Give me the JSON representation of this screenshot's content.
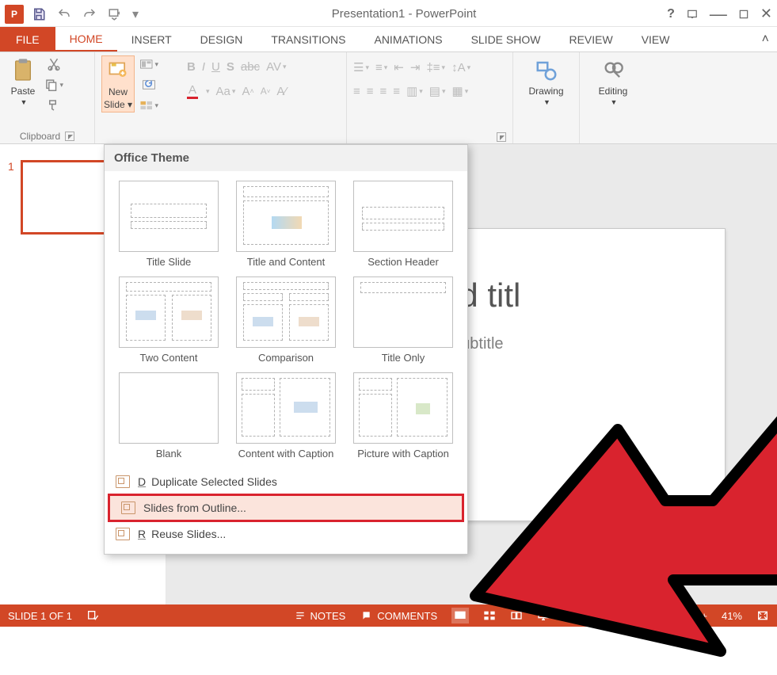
{
  "titlebar": {
    "title": "Presentation1 - PowerPoint"
  },
  "tabs": {
    "file": "FILE",
    "home": "HOME",
    "insert": "INSERT",
    "design": "DESIGN",
    "transitions": "TRANSITIONS",
    "animations": "ANIMATIONS",
    "slideshow": "SLIDE SHOW",
    "review": "REVIEW",
    "view": "VIEW"
  },
  "ribbon": {
    "clipboard": {
      "paste": "Paste",
      "label": "Clipboard"
    },
    "slides": {
      "new": "New",
      "slide": "Slide ▾"
    },
    "drawing": {
      "label": "Drawing"
    },
    "editing": {
      "label": "Editing"
    }
  },
  "gallery": {
    "header": "Office Theme",
    "layouts": [
      "Title Slide",
      "Title and Content",
      "Section Header",
      "Two Content",
      "Comparison",
      "Title Only",
      "Blank",
      "Content with Caption",
      "Picture with Caption"
    ],
    "footer": {
      "duplicate": "Duplicate Selected Slides",
      "outline": "Slides from Outline...",
      "reuse": "Reuse Slides..."
    }
  },
  "thumb": {
    "num": "1"
  },
  "slide": {
    "title": "add titl",
    "sub": "d subtitle"
  },
  "status": {
    "slide": "SLIDE 1 OF 1",
    "notes": "NOTES",
    "comments": "COMMENTS",
    "zoom": "41%"
  }
}
